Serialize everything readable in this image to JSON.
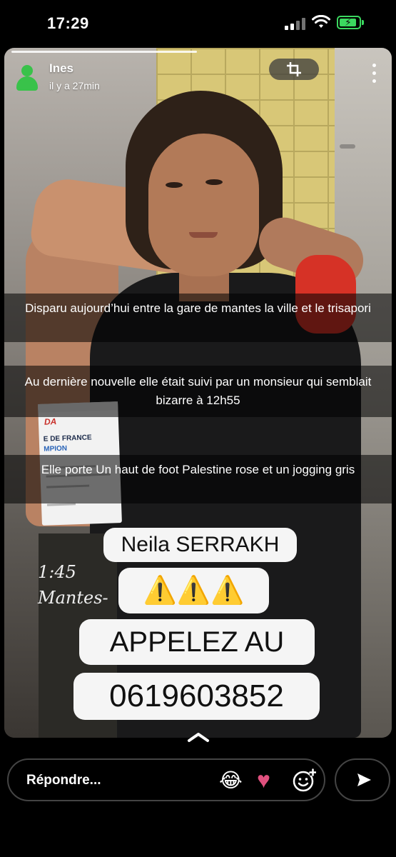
{
  "status_bar": {
    "time": "17:29"
  },
  "story": {
    "author": "Ines",
    "time_ago": "il y a 27min",
    "captions": [
      "Disparu aujourd’hui entre la gare de mantes la ville et le trisapori",
      "Au dernière nouvelle elle était suivi par un monsieur qui semblait bizarre à 12h55",
      "Elle porte Un haut de foot Palestine rose et un jogging gris"
    ],
    "name_chip": "Neila SERRAKH",
    "warning_chip": "⚠️⚠️⚠️",
    "call_chip": "APPELEZ AU",
    "phone_chip": "0619603852",
    "photo_text": {
      "certificate_line1": "E DE FRANCE",
      "certificate_line2": "MPION",
      "certificate_logo": "DA",
      "handwritten_1": "1:45",
      "handwritten_2": "Mantes-"
    }
  },
  "reply_bar": {
    "placeholder": "Répondre...",
    "reactions": [
      "laughing-emoji",
      "heart-emoji",
      "add-reaction"
    ]
  },
  "colors": {
    "avatar": "#39c24a",
    "battery": "#3bd85f",
    "heart": "#e0507e"
  }
}
